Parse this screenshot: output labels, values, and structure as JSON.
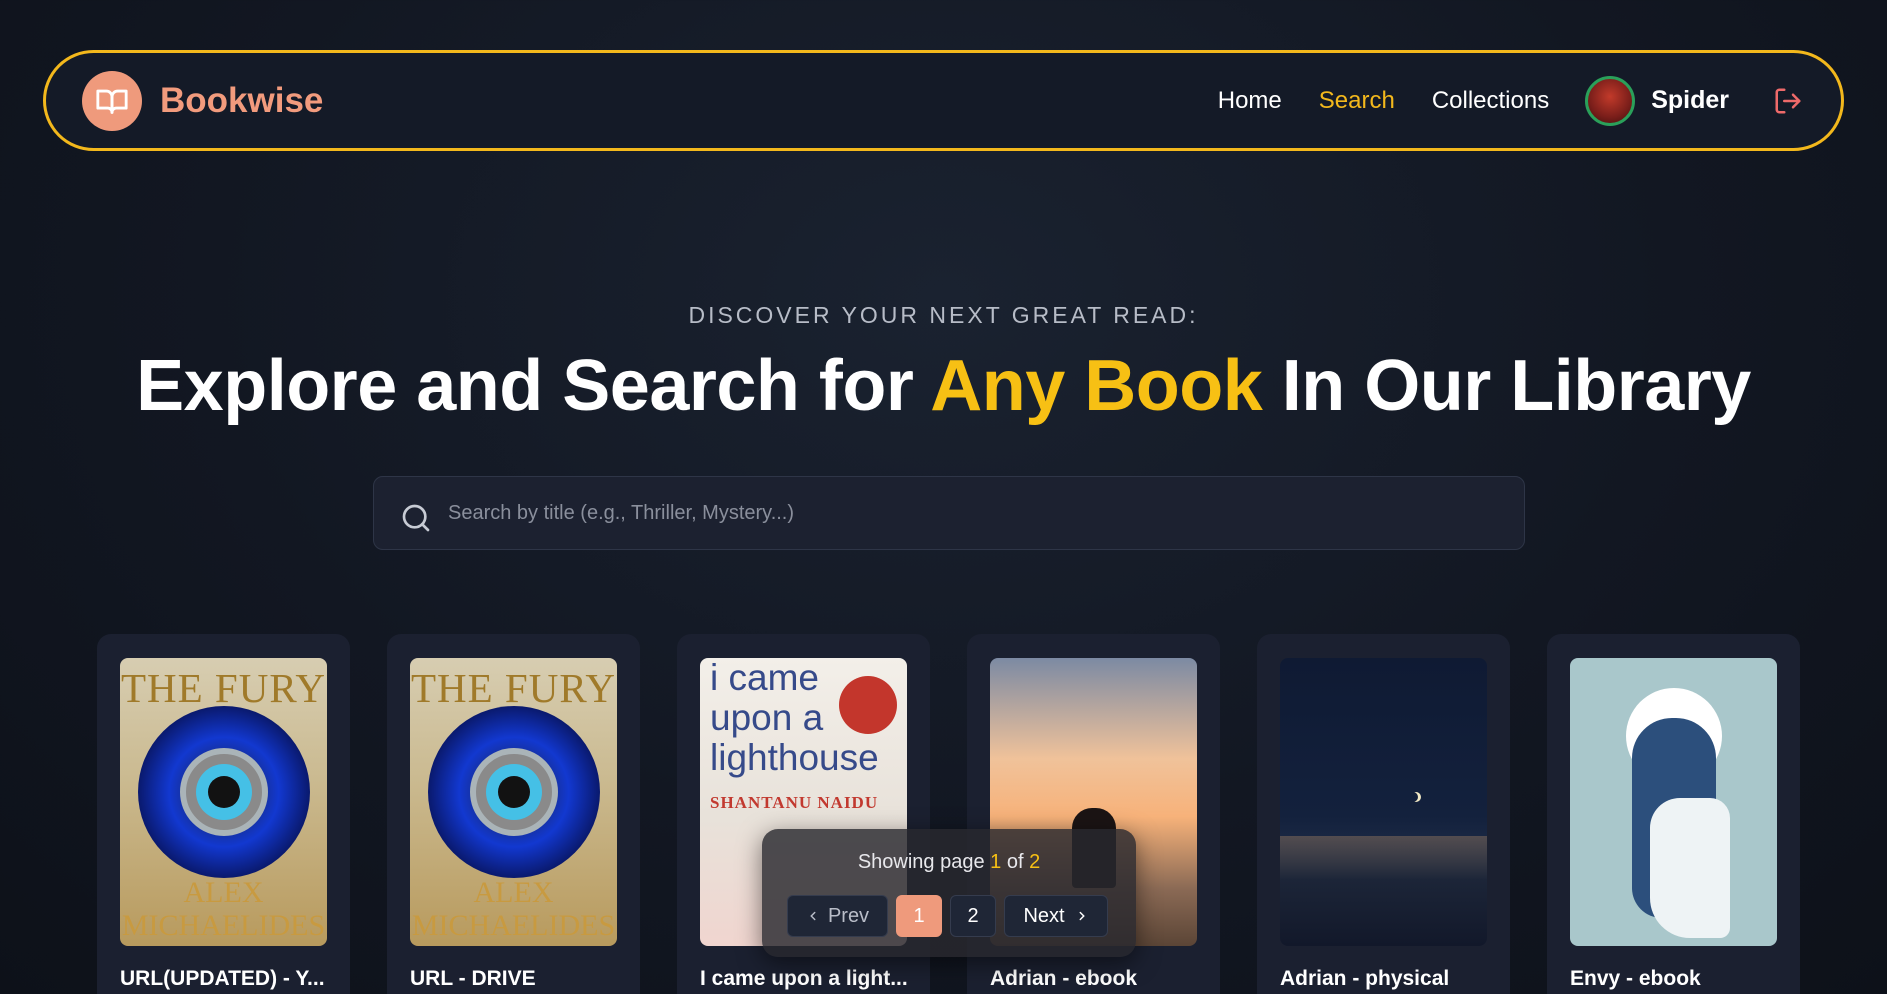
{
  "brand": {
    "name": "Bookwise",
    "logo_icon": "open-book-icon",
    "accent": "#ef9a7c"
  },
  "nav": {
    "links": [
      {
        "label": "Home",
        "active": false
      },
      {
        "label": "Search",
        "active": true
      },
      {
        "label": "Collections",
        "active": false
      }
    ],
    "user_name": "Spider",
    "logout_icon": "logout-icon",
    "border_color": "#f3b81c"
  },
  "hero": {
    "eyebrow": "DISCOVER YOUR NEXT GREAT READ:",
    "headline_pre": "Explore and Search for ",
    "headline_highlight": "Any Book",
    "headline_post": " In Our Library",
    "highlight_color": "#f7c014"
  },
  "search": {
    "placeholder": "Search by title (e.g., Thriller, Mystery...)",
    "value": "",
    "icon": "search-icon"
  },
  "books": [
    {
      "title": "URL(UPDATED) - Y...",
      "cover_title": "THE FURY",
      "cover_author_1": "ALEX",
      "cover_author_2": "MICHAELIDES"
    },
    {
      "title": "URL - DRIVE",
      "cover_title": "THE FURY",
      "cover_author_1": "ALEX",
      "cover_author_2": "MICHAELIDES"
    },
    {
      "title": "I came upon a light...",
      "cover_line_1": "i came",
      "cover_line_2": "upon a",
      "cover_line_3": "lighthouse",
      "cover_author": "SHANTANU NAIDU"
    },
    {
      "title": "Adrian - ebook"
    },
    {
      "title": "Adrian - physical"
    },
    {
      "title": "Envy - ebook"
    }
  ],
  "pagination": {
    "text_pre": "Showing page ",
    "current": "1",
    "text_mid": " of ",
    "total": "2",
    "prev_label": "Prev",
    "next_label": "Next",
    "pages": [
      "1",
      "2"
    ]
  }
}
